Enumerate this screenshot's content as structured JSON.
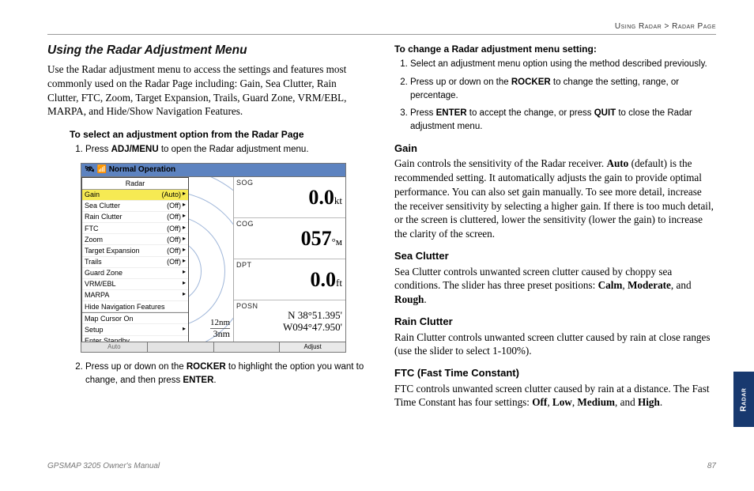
{
  "breadcrumb": {
    "section": "Using Radar",
    "sep": ">",
    "page": "Radar Page"
  },
  "left": {
    "heading": "Using the Radar Adjustment Menu",
    "intro": "Use the Radar adjustment menu to access the settings and features most commonly used on the Radar Page including: Gain, Sea Clutter, Rain Clutter, FTC, Zoom, Target Expansion, Trails, Guard Zone, VRM/EBL, MARPA, and Hide/Show Navigation Features.",
    "sub1": "To select an adjustment option from the Radar Page",
    "step1a": "Press ",
    "step1b": "ADJ/MENU",
    "step1c": " to open the Radar adjustment menu.",
    "step2a": "Press up or down on the ",
    "step2b": "ROCKER",
    "step2c": " to highlight the option you want to change, and then press ",
    "step2d": "ENTER",
    "step2e": "."
  },
  "fig": {
    "title_left": "🛰 📶 Normal Operation",
    "menu_title": "Radar",
    "rows": [
      {
        "label": "Gain",
        "val": "(Auto)",
        "sel": true,
        "arrow": true
      },
      {
        "label": "Sea Clutter",
        "val": "(Off)",
        "arrow": true
      },
      {
        "label": "Rain Clutter",
        "val": "(Off)",
        "arrow": true
      },
      {
        "label": "FTC",
        "val": "(Off)",
        "arrow": true
      },
      {
        "label": "Zoom",
        "val": "(Off)",
        "arrow": true
      },
      {
        "label": "Target Expansion",
        "val": "(Off)",
        "arrow": true
      },
      {
        "label": "Trails",
        "val": "(Off)",
        "arrow": true
      },
      {
        "label": "Guard Zone",
        "arrow": true
      },
      {
        "label": "VRM/EBL",
        "arrow": true
      },
      {
        "label": "MARPA",
        "arrow": true
      },
      {
        "label": "Hide Navigation Features"
      },
      {
        "sep": true
      },
      {
        "label": "Map Cursor On"
      },
      {
        "label": "Setup",
        "arrow": true
      },
      {
        "label": "Enter Standby"
      }
    ],
    "range1": "12nm",
    "range2": "3nm",
    "cells": [
      {
        "label": "SOG",
        "big": "0.0",
        "unit": "kt"
      },
      {
        "label": "COG",
        "big": "057",
        "unit": "°ᴍ",
        "deg": true
      },
      {
        "label": "DPT",
        "big": "0.0",
        "unit": "ft"
      },
      {
        "label": "POSN",
        "l1": "N  38°51.395'",
        "l2": "W094°47.950'"
      }
    ],
    "footer": [
      "Auto",
      "",
      "",
      "Adjust"
    ]
  },
  "right": {
    "h1": "To change a Radar adjustment menu setting:",
    "s1": "Select an adjustment menu option using the method described previously.",
    "s2a": "Press up or down on the ",
    "s2b": "ROCKER",
    "s2c": " to change the setting, range, or percentage.",
    "s3a": "Press ",
    "s3b": "ENTER",
    "s3c": " to accept the change, or press ",
    "s3d": "QUIT",
    "s3e": " to close the Radar adjustment menu.",
    "gain_h": "Gain",
    "gain_p1": "Gain controls the sensitivity of the Radar receiver. ",
    "gain_b": "Auto",
    "gain_p2": " (default) is the recommended setting. It automatically adjusts the gain to provide optimal performance. You can also set gain manually. To see more detail, increase the receiver sensitivity by selecting a higher gain. If there is too much detail, or the screen is cluttered, lower the sensitivity (lower the gain) to increase the clarity of the screen.",
    "sea_h": "Sea Clutter",
    "sea_p1": "Sea Clutter controls unwanted screen clutter caused by choppy sea conditions. The slider has three preset positions: ",
    "sea_b1": "Calm",
    "sea_c1": ", ",
    "sea_b2": "Moderate",
    "sea_c2": ", and ",
    "sea_b3": "Rough",
    "sea_c3": ".",
    "rain_h": "Rain Clutter",
    "rain_p": "Rain Clutter controls unwanted screen clutter caused by rain at close ranges (use the slider to select 1-100%).",
    "ftc_h": "FTC (Fast Time Constant)",
    "ftc_p1": "FTC controls unwanted screen clutter caused by rain at a distance. The Fast Time Constant has four settings: ",
    "ftc_b1": "Off",
    "ftc_c1": ", ",
    "ftc_b2": "Low",
    "ftc_c2": ", ",
    "ftc_b3": "Medium",
    "ftc_c3": ", and ",
    "ftc_b4": "High",
    "ftc_c4": "."
  },
  "footer": {
    "left": "GPSMAP 3205 Owner's Manual",
    "right": "87"
  },
  "tab": "Radar"
}
